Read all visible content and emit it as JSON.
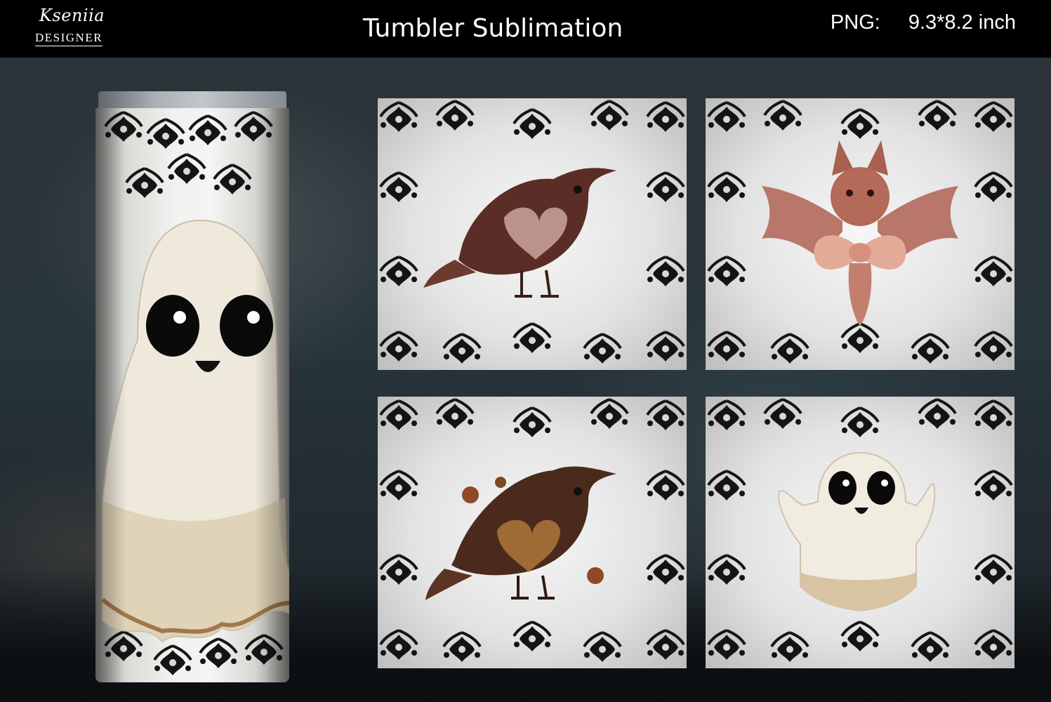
{
  "header": {
    "logo": {
      "script": "Kseniia",
      "subtitle": "DESIGNER"
    },
    "title": "Tumbler Sublimation",
    "spec": {
      "label": "PNG:",
      "value": "9.3*8.2 inch"
    }
  },
  "tumbler": {
    "design": "ghost-illustration"
  },
  "tiles": [
    {
      "design": "raven-heart-illustration"
    },
    {
      "design": "bat-bow-illustration"
    },
    {
      "design": "raven-flowers-illustration"
    },
    {
      "design": "ghost-illustration"
    }
  ],
  "colors": {
    "header_bg": "#000000",
    "lace": "#141414",
    "tile_bg": "#ececec",
    "raven_brown": "#5a2e26",
    "bat_pink": "#c77a66",
    "ghost_cream": "#f1ece0"
  }
}
